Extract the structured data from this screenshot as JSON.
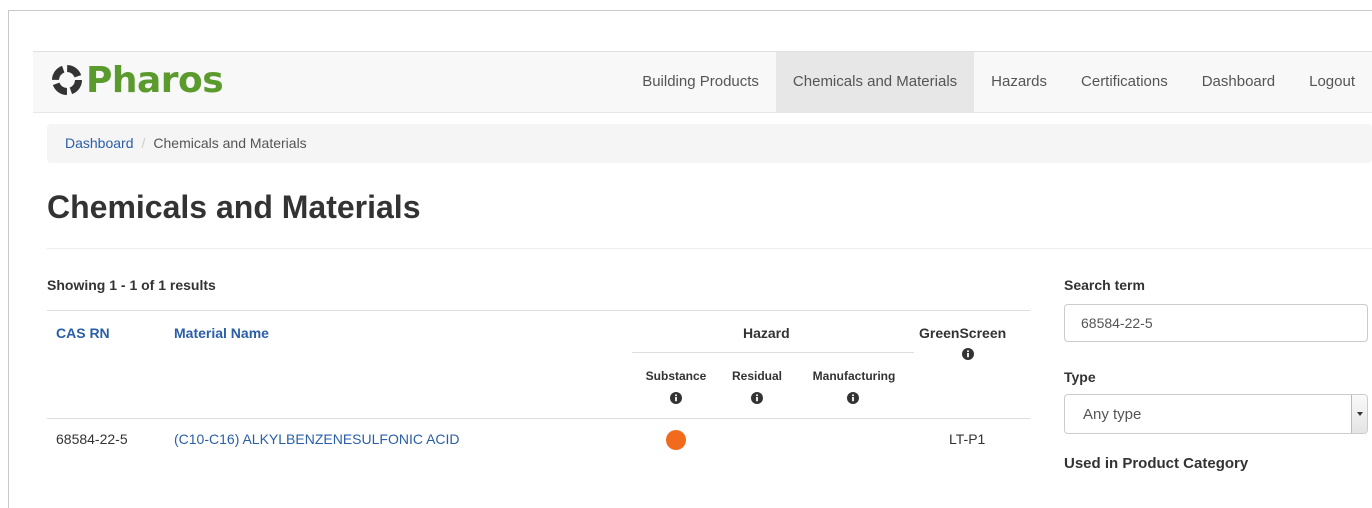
{
  "app": {
    "logo_text": "Pharos"
  },
  "nav": {
    "items": [
      {
        "label": "Building Products"
      },
      {
        "label": "Chemicals and Materials",
        "active": true
      },
      {
        "label": "Hazards"
      },
      {
        "label": "Certifications"
      },
      {
        "label": "Dashboard"
      },
      {
        "label": "Logout"
      }
    ]
  },
  "breadcrumb": {
    "home": "Dashboard",
    "separator": "/",
    "current": "Chemicals and Materials"
  },
  "page": {
    "title": "Chemicals and Materials"
  },
  "results": {
    "summary": "Showing 1 - 1 of 1 results",
    "columns": {
      "cas": "CAS RN",
      "material": "Material Name",
      "hazard": "Hazard",
      "hazard_sub": [
        "Substance",
        "Residual",
        "Manufacturing"
      ],
      "greenscreen": "GreenScreen"
    },
    "rows": [
      {
        "cas": "68584-22-5",
        "material": "(C10-C16) ALKYLBENZENESULFONIC ACID",
        "substance_hazard_color": "#f26b1d",
        "greenscreen": "LT-P1"
      }
    ]
  },
  "sidebar": {
    "search_label": "Search term",
    "search_value": "68584-22-5",
    "type_label": "Type",
    "type_value": "Any type",
    "category_label": "Used in Product Category"
  },
  "colors": {
    "brand": "#5b9b2e",
    "link": "#2a5fa8",
    "hazard_orange": "#f26b1d"
  }
}
